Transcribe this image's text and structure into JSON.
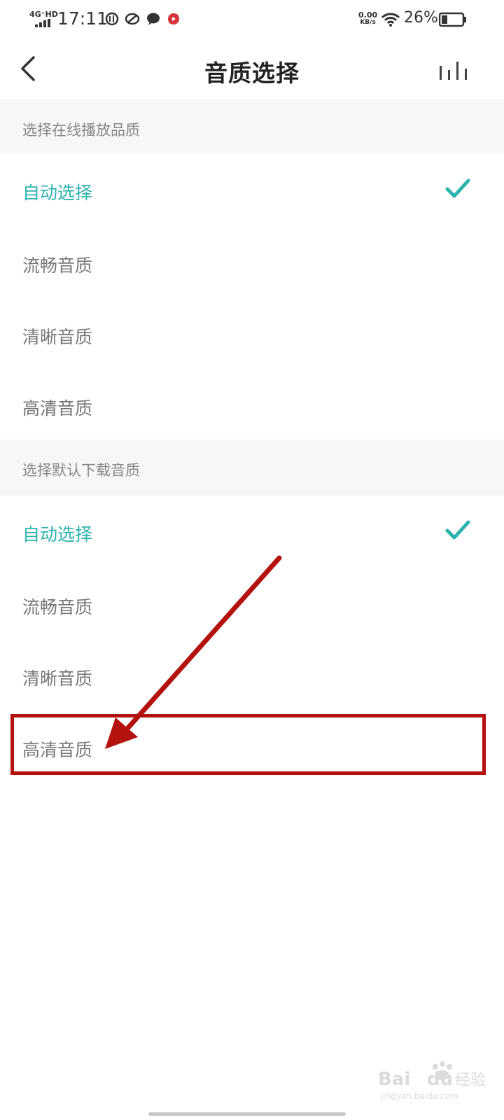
{
  "status_bar": {
    "network_type": "4G⁺HD",
    "time": "17:11",
    "app_icons": [
      "compass-app-icon",
      "link-app-icon",
      "chat-bubble-icon",
      "music-app-icon"
    ],
    "net_speed_value": "0.00",
    "net_speed_unit": "KB/s",
    "battery_percent": "26%"
  },
  "nav": {
    "title": "音质选择"
  },
  "sections": [
    {
      "header": "选择在线播放品质",
      "options": [
        {
          "label": "自动选择",
          "selected": true
        },
        {
          "label": "流畅音质",
          "selected": false
        },
        {
          "label": "清晰音质",
          "selected": false
        },
        {
          "label": "高清音质",
          "selected": false
        }
      ]
    },
    {
      "header": "选择默认下载音质",
      "options": [
        {
          "label": "自动选择",
          "selected": true
        },
        {
          "label": "流畅音质",
          "selected": false
        },
        {
          "label": "清晰音质",
          "selected": false
        },
        {
          "label": "高清音质",
          "selected": false
        }
      ]
    }
  ],
  "colors": {
    "accent": "#2bb3ad",
    "annotation": "#b3120f",
    "section_bg": "#f7f7f7"
  },
  "watermark": {
    "text": "Baidu经验",
    "url": "jingyan.baidu.com"
  }
}
